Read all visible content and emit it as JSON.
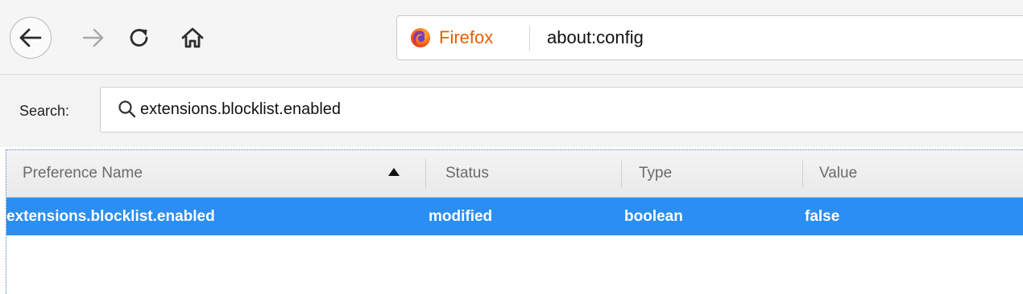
{
  "toolbar": {
    "back_icon": "arrow-left-icon",
    "forward_icon": "arrow-right-icon",
    "reload_icon": "reload-icon",
    "home_icon": "home-icon",
    "identity_label": "Firefox",
    "identity_icon": "firefox-logo-icon",
    "url": "about:config"
  },
  "search": {
    "label": "Search:",
    "value": "extensions.blocklist.enabled",
    "icon": "search-icon"
  },
  "table": {
    "columns": [
      "Preference Name",
      "Status",
      "Type",
      "Value"
    ],
    "sort_icon": "sort-ascending-icon",
    "rows": [
      {
        "name": "extensions.blocklist.enabled",
        "status": "modified",
        "type": "boolean",
        "value": "false",
        "selected": true
      }
    ]
  },
  "colors": {
    "selection": "#2b8ef2",
    "firefox_orange": "#e66000"
  }
}
